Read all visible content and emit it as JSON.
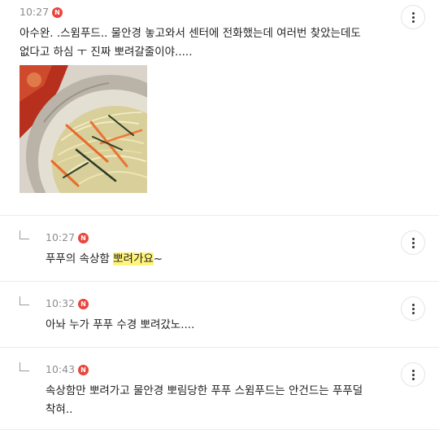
{
  "comments": [
    {
      "time": "10:27",
      "badge": "N",
      "lines": [
        "아수완. .스윔푸드.. 물안경 놓고와서 센터에 전화했는데 여러번 찾았는데도",
        "없다고 하심 ㅜ 진짜 뽀려갈줄이야....."
      ]
    },
    {
      "time": "10:27",
      "badge": "N",
      "text_before": "푸푸의 속상함 ",
      "text_highlight": "뽀려가요",
      "text_after": "~"
    },
    {
      "time": "10:32",
      "badge": "N",
      "text": "아놔 누가 푸푸 수경 뽀려갔노...."
    },
    {
      "time": "10:43",
      "badge": "N",
      "lines": [
        "속상함만 뽀려가고 물안경 뽀림당한 푸푸 스윔푸드는 안건드는 푸푸덜",
        "착혀.."
      ]
    }
  ],
  "icons": {
    "more": "more-vertical-icon",
    "reply": "reply-arrow-icon",
    "badge": "new-badge-icon"
  },
  "colors": {
    "badge": "#e8453c",
    "highlight": "#fff37a",
    "time": "#8e8e8e"
  }
}
